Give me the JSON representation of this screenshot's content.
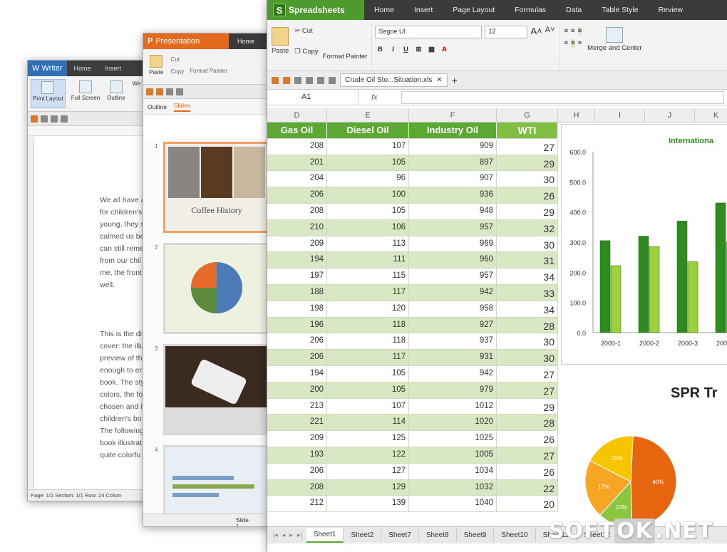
{
  "writer": {
    "app_title": "Writer",
    "tabs": [
      "Home",
      "Insert"
    ],
    "ribbon": [
      "Print Layout",
      "Full Screen",
      "Outline",
      "We"
    ],
    "para1": [
      "We all have a",
      "for children's",
      "young, they s",
      "calmed us be",
      "can still reme",
      "from our chil",
      "me, the front",
      "well."
    ],
    "para2": [
      "This is the dif",
      "cover: the illu",
      "preview of th",
      "enough to er",
      "book. The sty",
      "colors, the fo",
      "chosen and i",
      "children's bo",
      "The following",
      "book illustrat",
      "quite colorfu"
    ],
    "status": "Page: 1/1  Section: 1/1  Row: 24  Colum"
  },
  "presentation": {
    "app_title": "Presentation",
    "tabs": [
      "Home"
    ],
    "paste": "Paste",
    "cut": "Cut",
    "copy": "Copy",
    "format_painter": "Format Painter",
    "outline_tab": "Outline",
    "slides_tab": "Slides",
    "slide_numbers": [
      "1",
      "2",
      "3",
      "4"
    ],
    "slide1_caption": "Coffee History",
    "status": "Slide 1 /"
  },
  "spreadsheet": {
    "app_title": "Spreadsheets",
    "tabs": [
      "Home",
      "Insert",
      "Page Layout",
      "Formulas",
      "Data",
      "Table Style",
      "Review"
    ],
    "paste": "Paste",
    "cut": "Cut",
    "copy": "Copy",
    "format_painter": "Format Painter",
    "font_name": "Segoe UI",
    "font_size": "12",
    "merge_center": "Merge and Center",
    "doc_tab": "Crude Oil Sto...Situation.xls",
    "name_box": "A1",
    "fx": "fx",
    "col_letters": [
      "D",
      "E",
      "F",
      "G",
      "H",
      "I",
      "J",
      "K"
    ],
    "headers": [
      "Gas Oil",
      "Diesel Oil",
      "Industry Oil",
      "WTI"
    ],
    "rows": [
      [
        "208",
        "107",
        "909",
        "27"
      ],
      [
        "201",
        "105",
        "897",
        "29"
      ],
      [
        "204",
        "96",
        "907",
        "30"
      ],
      [
        "206",
        "100",
        "936",
        "26"
      ],
      [
        "208",
        "105",
        "948",
        "29"
      ],
      [
        "210",
        "106",
        "957",
        "32"
      ],
      [
        "209",
        "113",
        "969",
        "30"
      ],
      [
        "194",
        "111",
        "960",
        "31"
      ],
      [
        "197",
        "115",
        "957",
        "34"
      ],
      [
        "188",
        "117",
        "942",
        "33"
      ],
      [
        "198",
        "120",
        "958",
        "34"
      ],
      [
        "196",
        "118",
        "927",
        "28"
      ],
      [
        "206",
        "118",
        "937",
        "30"
      ],
      [
        "206",
        "117",
        "931",
        "30"
      ],
      [
        "194",
        "105",
        "942",
        "27"
      ],
      [
        "200",
        "105",
        "979",
        "27"
      ],
      [
        "213",
        "107",
        "1012",
        "29"
      ],
      [
        "221",
        "114",
        "1020",
        "28"
      ],
      [
        "209",
        "125",
        "1025",
        "26"
      ],
      [
        "193",
        "122",
        "1005",
        "27"
      ],
      [
        "206",
        "127",
        "1034",
        "26"
      ],
      [
        "208",
        "129",
        "1032",
        "22"
      ],
      [
        "212",
        "139",
        "1040",
        "20"
      ]
    ],
    "sheet_tabs": [
      "Sheet1",
      "Sheet2",
      "Sheet7",
      "Sheet8",
      "Sheet9",
      "Sheet10",
      "Sheet11",
      "Sheet12"
    ]
  },
  "chart_data": [
    {
      "type": "bar",
      "title": "Internationa",
      "categories": [
        "2000-1",
        "2000-2",
        "2000-3",
        "2000-4"
      ],
      "series": [
        {
          "values": [
            305,
            320,
            370,
            430
          ],
          "color": "#2e8b1e"
        },
        {
          "values": [
            222,
            285,
            235,
            300
          ],
          "color": "#9bd23c"
        }
      ],
      "ylim": [
        0,
        600
      ],
      "yticks": [
        "0.0",
        "100.0",
        "200.0",
        "300.0",
        "400.0",
        "500.0",
        "600.0"
      ],
      "grid": false
    },
    {
      "type": "pie",
      "title": "SPR Tr",
      "labels": [
        "40%",
        "10%",
        "17%",
        "15%"
      ],
      "values": [
        40,
        10,
        17,
        15
      ],
      "colors": [
        "#e8650f",
        "#8cc63f",
        "#f5a623",
        "#f7c500"
      ]
    }
  ],
  "watermark": {
    "a": "SOFT",
    "b": "OK",
    "c": ".NET"
  }
}
